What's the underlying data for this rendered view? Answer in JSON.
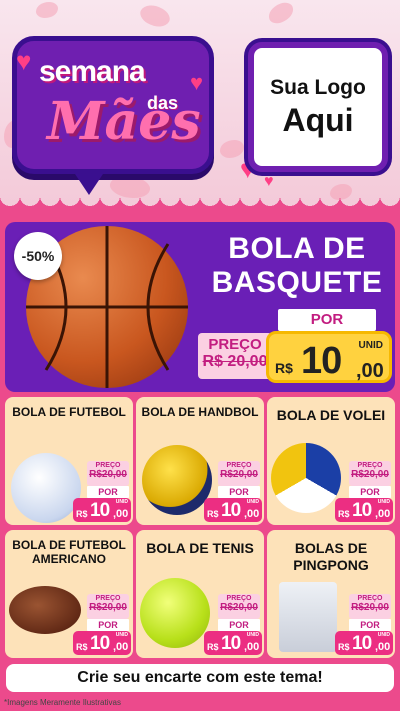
{
  "header": {
    "title_line1": "semana",
    "title_word_das": "das",
    "title_line2": "Mães",
    "logo_line1": "Sua Logo",
    "logo_line2": "Aqui"
  },
  "hero": {
    "discount": "-50%",
    "name": "BOLA DE BASQUETE",
    "por_label": "POR",
    "preco_label": "PREÇO",
    "old_price": "R$ 20,00",
    "currency": "R$",
    "price_int": "10",
    "price_dec": ",00",
    "unid": "UNID"
  },
  "products": [
    {
      "name": "BOLA DE FUTEBOL",
      "preco_label": "PREÇO",
      "old_price": "R$20,00",
      "por_label": "POR",
      "currency": "R$",
      "price_int": "10",
      "price_dec": ",00",
      "unid": "UNID"
    },
    {
      "name": "BOLA DE HANDBOL",
      "preco_label": "PREÇO",
      "old_price": "R$20,00",
      "por_label": "POR",
      "currency": "R$",
      "price_int": "10",
      "price_dec": ",00",
      "unid": "UNID"
    },
    {
      "name": "BOLA DE VOLEI",
      "preco_label": "PREÇO",
      "old_price": "R$20,00",
      "por_label": "POR",
      "currency": "R$",
      "price_int": "10",
      "price_dec": ",00",
      "unid": "UNID"
    },
    {
      "name": "BOLA DE FUTEBOL AMERICANO",
      "preco_label": "PREÇO",
      "old_price": "R$20,00",
      "por_label": "POR",
      "currency": "R$",
      "price_int": "10",
      "price_dec": ",00",
      "unid": "UNID"
    },
    {
      "name": "BOLA DE TENIS",
      "preco_label": "PREÇO",
      "old_price": "R$20,00",
      "por_label": "POR",
      "currency": "R$",
      "price_int": "10",
      "price_dec": ",00",
      "unid": "UNID"
    },
    {
      "name": "BOLAS DE PINGPONG",
      "preco_label": "PREÇO",
      "old_price": "R$20,00",
      "por_label": "POR",
      "currency": "R$",
      "price_int": "10",
      "price_dec": ",00",
      "unid": "UNID"
    }
  ],
  "footer": {
    "cta": "Crie seu encarte com este tema!",
    "footnote": "*Imagens Meramente Ilustrativas"
  },
  "colors": {
    "pink": "#ec4a8c",
    "purple": "#6a1fb6",
    "yellow": "#ffd23f",
    "card": "#fde2b9"
  }
}
